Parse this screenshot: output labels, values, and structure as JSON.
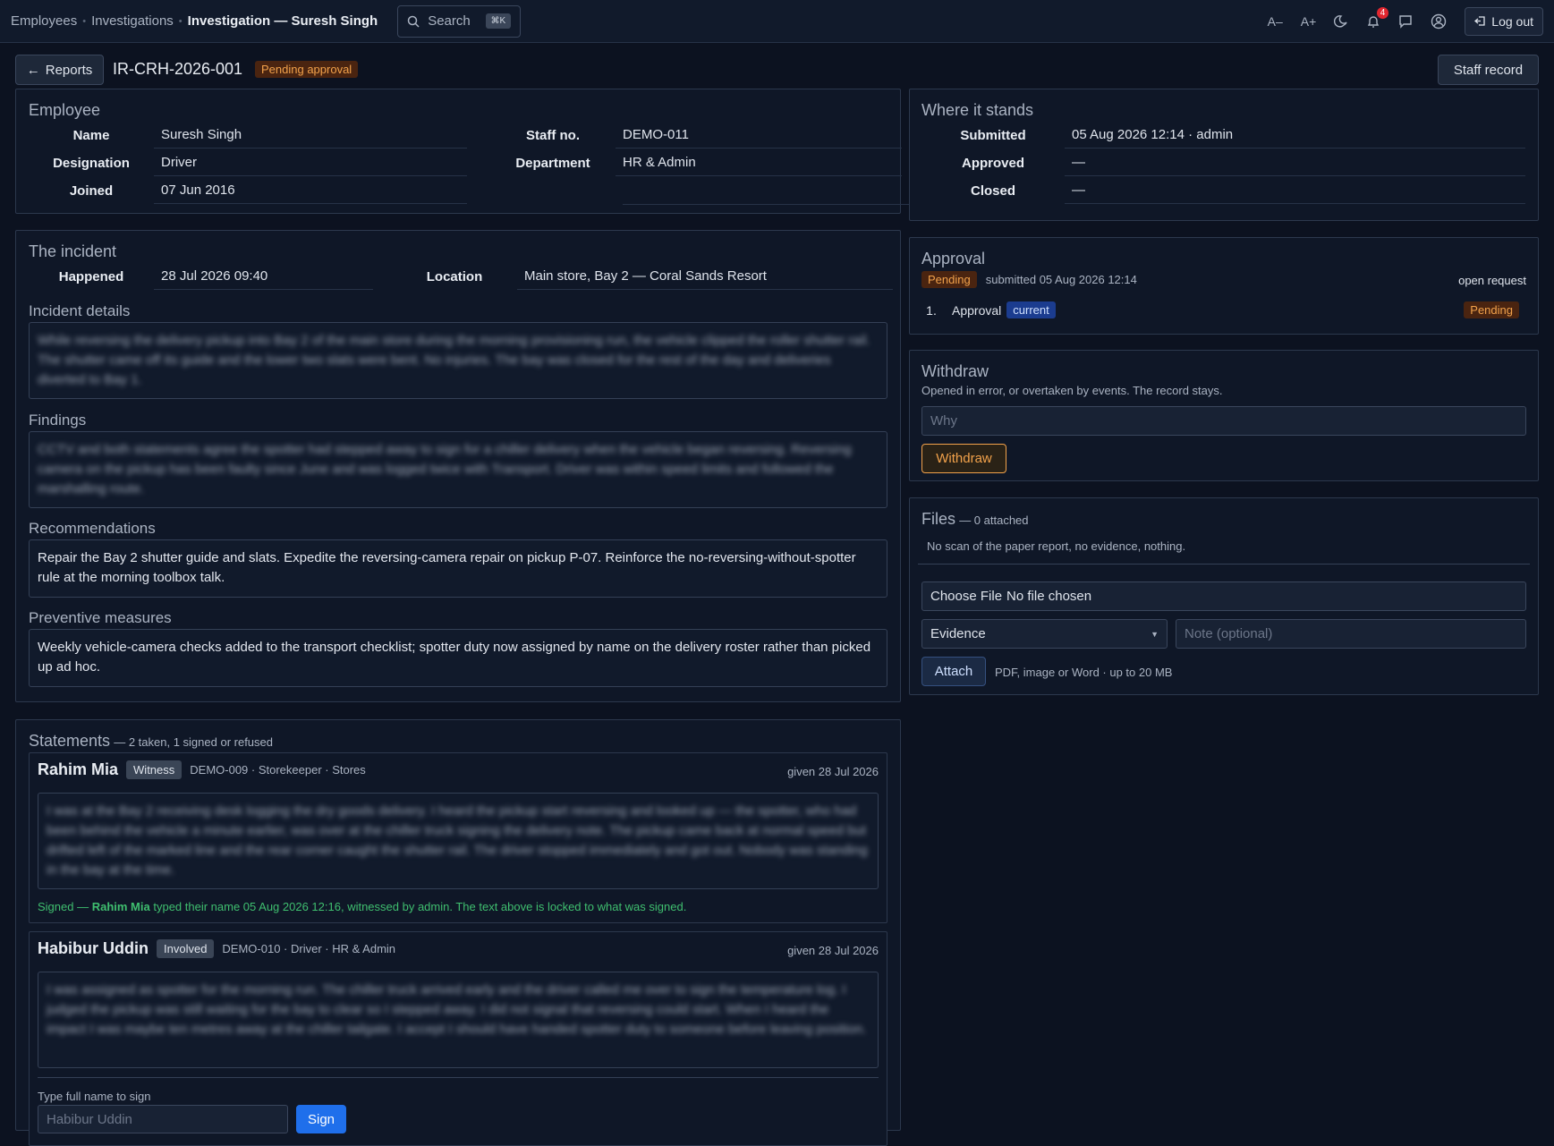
{
  "topbar": {
    "crumbs": [
      "Employees",
      "Investigations"
    ],
    "current": "Investigation — Suresh Singh",
    "search_label": "Search",
    "search_kbd": "⌘K",
    "font_smaller": "A–",
    "font_larger": "A+",
    "notifications_count": "4",
    "logout_label": "Log out"
  },
  "header": {
    "back_label": "Reports",
    "report_id": "IR-CRH-2026-001",
    "status": "Pending approval",
    "staff_record_label": "Staff record"
  },
  "employee": {
    "title": "Employee",
    "name_label": "Name",
    "name": "Suresh Singh",
    "staff_no_label": "Staff no.",
    "staff_no": "DEMO-011",
    "designation_label": "Designation",
    "designation": "Driver",
    "department_label": "Department",
    "department": "HR & Admin",
    "joined_label": "Joined",
    "joined": "07 Jun 2016"
  },
  "incident": {
    "title": "The incident",
    "happened_label": "Happened",
    "happened": "28 Jul 2026 09:40",
    "location_label": "Location",
    "location": "Main store, Bay 2 — Coral Sands Resort",
    "details_label": "Incident details",
    "details": "While reversing the delivery pickup into Bay 2 of the main store during the morning provisioning run, the vehicle clipped the roller shutter rail. The shutter came off its guide and the lower two slats were bent. No injuries. The bay was closed for the rest of the day and deliveries diverted to Bay 1.",
    "findings_label": "Findings",
    "findings": "CCTV and both statements agree the spotter had stepped away to sign for a chiller delivery when the vehicle began reversing. Reversing camera on the pickup has been faulty since June and was logged twice with Transport. Driver was within speed limits and followed the marshalling route.",
    "recommendations_label": "Recommendations",
    "recommendations": "Repair the Bay 2 shutter guide and slats. Expedite the reversing-camera repair on pickup P-07. Reinforce the no-reversing-without-spotter rule at the morning toolbox talk.",
    "preventive_label": "Preventive measures",
    "preventive": "Weekly vehicle-camera checks added to the transport checklist; spotter duty now assigned by name on the delivery roster rather than picked up ad hoc."
  },
  "statements": {
    "title": "Statements",
    "summary": "— 2 taken, 1 signed or refused",
    "items": [
      {
        "name": "Rahim Mia",
        "role": "Witness",
        "meta": "DEMO-009 · Storekeeper · Stores",
        "given": "given 28 Jul 2026",
        "text": "I was at the Bay 2 receiving desk logging the dry goods delivery. I heard the pickup start reversing and looked up — the spotter, who had been behind the vehicle a minute earlier, was over at the chiller truck signing the delivery note. The pickup came back at normal speed but drifted left of the marked line and the rear corner caught the shutter rail. The driver stopped immediately and got out. Nobody was standing in the bay at the time.",
        "signed_prefix": "Signed —",
        "signed_name": "Rahim Mia",
        "signed_suffix": "typed their name 05 Aug 2026 12:16, witnessed by admin. The text above is locked to what was signed."
      },
      {
        "name": "Habibur Uddin",
        "role": "Involved",
        "meta": "DEMO-010 · Driver · HR & Admin",
        "given": "given 28 Jul 2026",
        "text": "I was assigned as spotter for the morning run. The chiller truck arrived early and the driver called me over to sign the temperature log. I judged the pickup was still waiting for the bay to clear so I stepped away. I did not signal that reversing could start. When I heard the impact I was maybe ten metres away at the chiller tailgate. I accept I should have handed spotter duty to someone before leaving position.",
        "sign_label": "Type full name to sign",
        "sign_placeholder": "Habibur Uddin",
        "sign_button": "Sign"
      }
    ]
  },
  "status_panel": {
    "title": "Where it stands",
    "submitted_label": "Submitted",
    "submitted": "05 Aug 2026 12:14 · admin",
    "approved_label": "Approved",
    "approved": "—",
    "closed_label": "Closed",
    "closed": "—"
  },
  "approval": {
    "title": "Approval",
    "status": "Pending",
    "submitted": "submitted 05 Aug 2026 12:14",
    "open_request": "open request",
    "step_no": "1.",
    "step_name": "Approval",
    "step_tag": "current",
    "step_status": "Pending"
  },
  "withdraw": {
    "title": "Withdraw",
    "desc": "Opened in error, or overtaken by events. The record stays.",
    "placeholder": "Why",
    "button": "Withdraw"
  },
  "files": {
    "title": "Files",
    "count": "— 0 attached",
    "empty": "No scan of the paper report, no evidence, nothing.",
    "choose_button": "Choose File",
    "no_file": "No file chosen",
    "type_selected": "Evidence",
    "note_placeholder": "Note (optional)",
    "attach_button": "Attach",
    "hint": "PDF, image or Word · up to 20 MB"
  },
  "colors": {
    "accent": "#1f6feb",
    "pending": "#f2a24b",
    "signed": "#3fbf6f"
  }
}
